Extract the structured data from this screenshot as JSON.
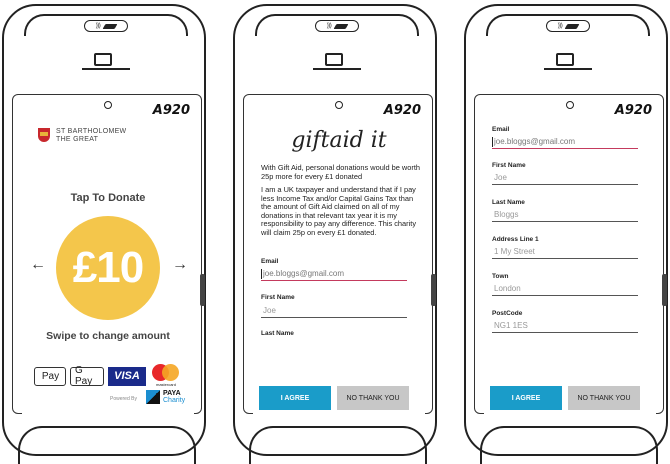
{
  "device_model": "A920",
  "screen1": {
    "org_line1": "ST BARTHOLOMEW",
    "org_line2": "THE GREAT",
    "tap_text": "Tap To Donate",
    "amount": "£10",
    "left_arrow": "←",
    "right_arrow": "→",
    "swipe_text": "Swipe to change amount",
    "apple_pay": "Pay",
    "google_pay": "G Pay",
    "visa": "VISA",
    "mastercard": "mastercard",
    "powered_by": "Powered By",
    "paya_line1": "PAYA",
    "paya_line2": "Charity"
  },
  "screen2": {
    "logo_text": "giftaid it",
    "intro": "With Gift Aid, personal donations would be worth 25p more for every £1 donated",
    "declaration": "I am a UK taxpayer and understand that if I pay less Income Tax and/or Capital Gains Tax than the amount of Gift Aid claimed on all of my donations in that relevant tax year it is my responsibility to pay any difference. This charity will claim 25p on every £1 donated.",
    "email_label": "Email",
    "email_value": "joe.bloggs@gmail.com",
    "first_name_label": "First Name",
    "first_name_value": "Joe",
    "last_name_label": "Last Name",
    "agree_label": "I AGREE",
    "no_label": "NO THANK YOU"
  },
  "screen3": {
    "email_label": "Email",
    "email_value": "joe.bloggs@gmail.com",
    "first_name_label": "First Name",
    "first_name_value": "Joe",
    "last_name_label": "Last Name",
    "last_name_value": "Bloggs",
    "address_label": "Address Line 1",
    "address_value": "1 My Street",
    "town_label": "Town",
    "town_value": "London",
    "postcode_label": "PostCode",
    "postcode_value": "NG1 1ES",
    "agree_label": "I AGREE",
    "no_label": "NO THANK YOU"
  },
  "colors": {
    "coin": "#f4c64b",
    "agree_button": "#1a9cc9",
    "no_button": "#c7c7c7",
    "active_underline": "#c43a5d"
  }
}
